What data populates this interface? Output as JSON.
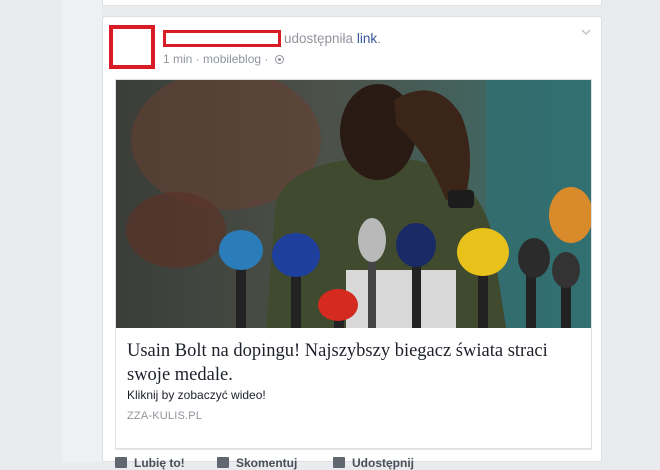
{
  "post": {
    "action_text": "udostępniła",
    "link_text": "link",
    "time": "1 min",
    "separator": "·",
    "source": "mobileblog",
    "separator2": "·",
    "privacy_icon": "globe-icon",
    "options_icon": "chevron-down-icon"
  },
  "preview": {
    "title": "Usain Bolt na dopingu! Najszybszy biegacz świata straci swoje medale.",
    "description": "Kliknij by zobaczyć wideo!",
    "domain": "ZZA-KULIS.PL"
  },
  "actions": {
    "like": "Lubię to!",
    "comment": "Skomentuj",
    "share": "Udostępnij"
  },
  "colors": {
    "redaction": "#d81b25",
    "link": "#365899",
    "meta": "#90949c"
  }
}
